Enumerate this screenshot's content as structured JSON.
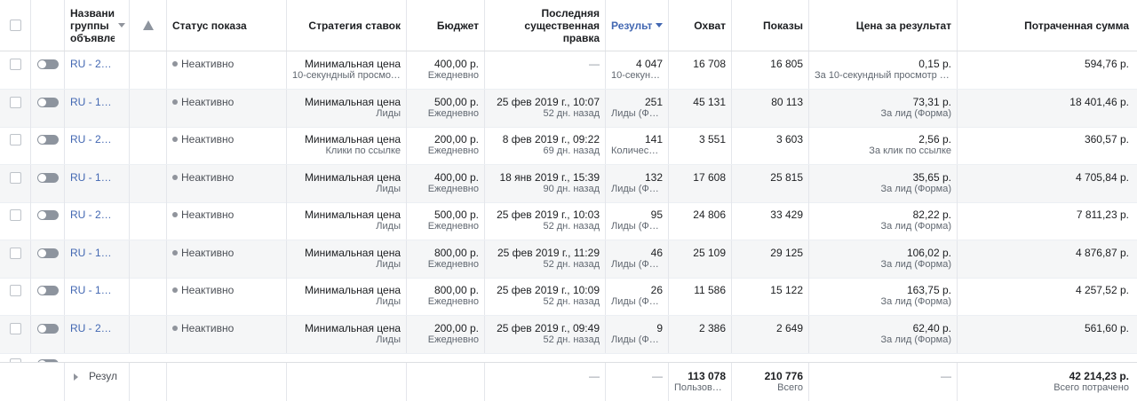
{
  "header": {
    "name": "Название группы объявле",
    "status": "Статус показа",
    "strategy": "Стратегия ставок",
    "budget": "Бюджет",
    "last_edit": "Последняя существенная правка",
    "results": "Результ",
    "reach": "Охват",
    "impressions": "Показы",
    "cost": "Цена за результат",
    "spent": "Потраченная сумма"
  },
  "rows": [
    {
      "name": "RU - 2…",
      "status": "Неактивно",
      "strategy": "Минимальная цена",
      "strategy_sub": "10-секундный просмот…",
      "budget": "400,00 р.",
      "budget_sub": "Ежедневно",
      "edit": "—",
      "edit_sub": "",
      "results": "4 047",
      "results_sub": "10-секунд…",
      "reach": "16 708",
      "impressions": "16 805",
      "cost": "0,15 р.",
      "cost_sub": "За 10-секундный просмотр ви…",
      "spent": "594,76 р."
    },
    {
      "name": "RU - 1…",
      "status": "Неактивно",
      "strategy": "Минимальная цена",
      "strategy_sub": "Лиды",
      "budget": "500,00 р.",
      "budget_sub": "Ежедневно",
      "edit": "25 фев 2019 г., 10:07",
      "edit_sub": "52 дн. назад",
      "results": "251",
      "results_sub": "Лиды (Фо…",
      "reach": "45 131",
      "impressions": "80 113",
      "cost": "73,31 р.",
      "cost_sub": "За лид (Форма)",
      "spent": "18 401,46 р."
    },
    {
      "name": "RU - 2…",
      "status": "Неактивно",
      "strategy": "Минимальная цена",
      "strategy_sub": "Клики по ссылке",
      "budget": "200,00 р.",
      "budget_sub": "Ежедневно",
      "edit": "8 фев 2019 г., 09:22",
      "edit_sub": "69 дн. назад",
      "results": "141",
      "results_sub": "Количест…",
      "reach": "3 551",
      "impressions": "3 603",
      "cost": "2,56 р.",
      "cost_sub": "За клик по ссылке",
      "spent": "360,57 р."
    },
    {
      "name": "RU - 1…",
      "status": "Неактивно",
      "strategy": "Минимальная цена",
      "strategy_sub": "Лиды",
      "budget": "400,00 р.",
      "budget_sub": "Ежедневно",
      "edit": "18 янв 2019 г., 15:39",
      "edit_sub": "90 дн. назад",
      "results": "132",
      "results_sub": "Лиды (Фо…",
      "reach": "17 608",
      "impressions": "25 815",
      "cost": "35,65 р.",
      "cost_sub": "За лид (Форма)",
      "spent": "4 705,84 р."
    },
    {
      "name": "RU - 2…",
      "status": "Неактивно",
      "strategy": "Минимальная цена",
      "strategy_sub": "Лиды",
      "budget": "500,00 р.",
      "budget_sub": "Ежедневно",
      "edit": "25 фев 2019 г., 10:03",
      "edit_sub": "52 дн. назад",
      "results": "95",
      "results_sub": "Лиды (Фо…",
      "reach": "24 806",
      "impressions": "33 429",
      "cost": "82,22 р.",
      "cost_sub": "За лид (Форма)",
      "spent": "7 811,23 р."
    },
    {
      "name": "RU - 1…",
      "status": "Неактивно",
      "strategy": "Минимальная цена",
      "strategy_sub": "Лиды",
      "budget": "800,00 р.",
      "budget_sub": "Ежедневно",
      "edit": "25 фев 2019 г., 11:29",
      "edit_sub": "52 дн. назад",
      "results": "46",
      "results_sub": "Лиды (Фо…",
      "reach": "25 109",
      "impressions": "29 125",
      "cost": "106,02 р.",
      "cost_sub": "За лид (Форма)",
      "spent": "4 876,87 р."
    },
    {
      "name": "RU - 1…",
      "status": "Неактивно",
      "strategy": "Минимальная цена",
      "strategy_sub": "Лиды",
      "budget": "800,00 р.",
      "budget_sub": "Ежедневно",
      "edit": "25 фев 2019 г., 10:09",
      "edit_sub": "52 дн. назад",
      "results": "26",
      "results_sub": "Лиды (Фо…",
      "reach": "11 586",
      "impressions": "15 122",
      "cost": "163,75 р.",
      "cost_sub": "За лид (Форма)",
      "spent": "4 257,52 р."
    },
    {
      "name": "RU - 2…",
      "status": "Неактивно",
      "strategy": "Минимальная цена",
      "strategy_sub": "Лиды",
      "budget": "200,00 р.",
      "budget_sub": "Ежедневно",
      "edit": "25 фев 2019 г., 09:49",
      "edit_sub": "52 дн. назад",
      "results": "9",
      "results_sub": "Лиды (Фо…",
      "reach": "2 386",
      "impressions": "2 649",
      "cost": "62,40 р.",
      "cost_sub": "За лид (Форма)",
      "spent": "561,60 р."
    }
  ],
  "footer": {
    "label": "Резул",
    "edit": "—",
    "results": "—",
    "reach": "113 078",
    "reach_sub": "Пользова…",
    "impressions": "210 776",
    "impressions_sub": "Всего",
    "cost": "—",
    "spent": "42 214,23 р.",
    "spent_sub": "Всего потрачено"
  },
  "colors": {
    "link": "#4267b2",
    "status_dot": "#90949c",
    "toggle_off": "#8d949e",
    "alt_row": "#f5f6f7"
  },
  "icons": {
    "warning": "warning-icon",
    "sort": "sort-desc-icon",
    "expand": "expand-triangle-icon"
  }
}
